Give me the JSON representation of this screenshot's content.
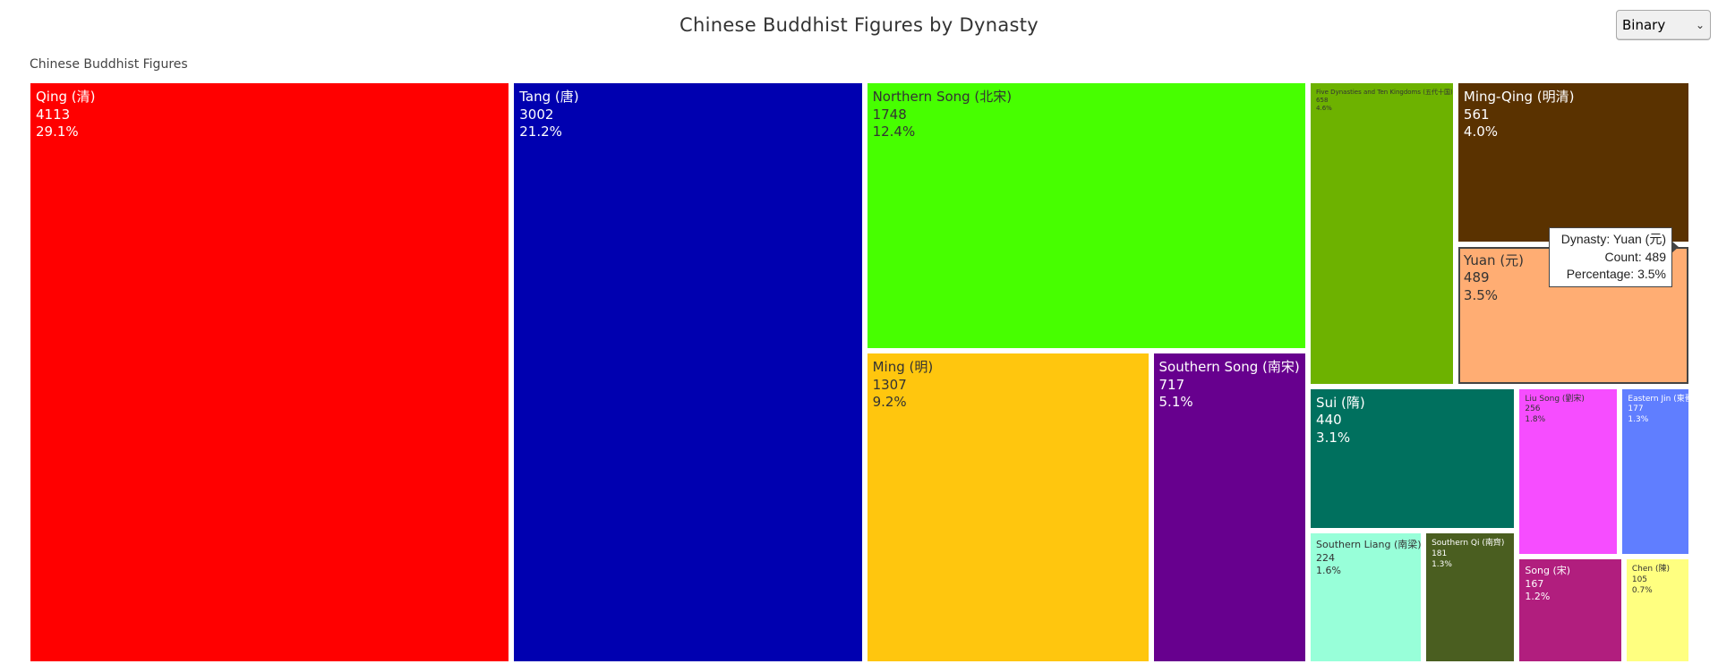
{
  "chart_data": {
    "type": "treemap",
    "title": "Chinese Buddhist Figures by Dynasty",
    "root_label": "Chinese Buddhist Figures",
    "items": [
      {
        "label": "Qing (清)",
        "value": 4113,
        "percent": "29.1%",
        "color": "#ff0000",
        "text_color": "#ffffff"
      },
      {
        "label": "Tang (唐)",
        "value": 3002,
        "percent": "21.2%",
        "color": "#0000b0",
        "text_color": "#ffffff"
      },
      {
        "label": "Northern Song (北宋)",
        "value": 1748,
        "percent": "12.4%",
        "color": "#47ff00",
        "text_color": "#333333"
      },
      {
        "label": "Ming (明)",
        "value": 1307,
        "percent": "9.2%",
        "color": "#ffc60e",
        "text_color": "#333333"
      },
      {
        "label": "Southern Song (南宋)",
        "value": 717,
        "percent": "5.1%",
        "color": "#67008e",
        "text_color": "#ffffff"
      },
      {
        "label": "Five Dynasties and Ten Kingdoms (五代十国)",
        "value": 658,
        "percent": "4.6%",
        "color": "#6db200",
        "text_color": "#333333"
      },
      {
        "label": "Ming-Qing (明清)",
        "value": 561,
        "percent": "4.0%",
        "color": "#5a3200",
        "text_color": "#ffffff"
      },
      {
        "label": "Yuan (元)",
        "value": 489,
        "percent": "3.5%",
        "color": "#ffad73",
        "text_color": "#333333"
      },
      {
        "label": "Sui (隋)",
        "value": 440,
        "percent": "3.1%",
        "color": "#00705e",
        "text_color": "#ffffff"
      },
      {
        "label": "Southern Liang (南梁)",
        "value": 224,
        "percent": "1.6%",
        "color": "#98ffd9",
        "text_color": "#333333"
      },
      {
        "label": "Southern Qi (南齊)",
        "value": 181,
        "percent": "1.3%",
        "color": "#4a5e20",
        "text_color": "#ffffff"
      },
      {
        "label": "Liu Song (劉宋)",
        "value": 256,
        "percent": "1.8%",
        "color": "#f64dff",
        "text_color": "#333333"
      },
      {
        "label": "Eastern Jin (東晉)",
        "value": 177,
        "percent": "1.3%",
        "color": "#607eff",
        "text_color": "#ffffff"
      },
      {
        "label": "Song (宋)",
        "value": 167,
        "percent": "1.2%",
        "color": "#b11e7e",
        "text_color": "#ffffff"
      },
      {
        "label": "Chen (陳)",
        "value": 105,
        "percent": "0.7%",
        "color": "#ffff80",
        "text_color": "#333333"
      }
    ]
  },
  "controls": {
    "mode_select": {
      "value": "Binary"
    }
  },
  "tooltip": {
    "dynasty_line": "Dynasty: Yuan (元)",
    "count_line": "Count: 489",
    "percent_line": "Percentage: 3.5%"
  }
}
